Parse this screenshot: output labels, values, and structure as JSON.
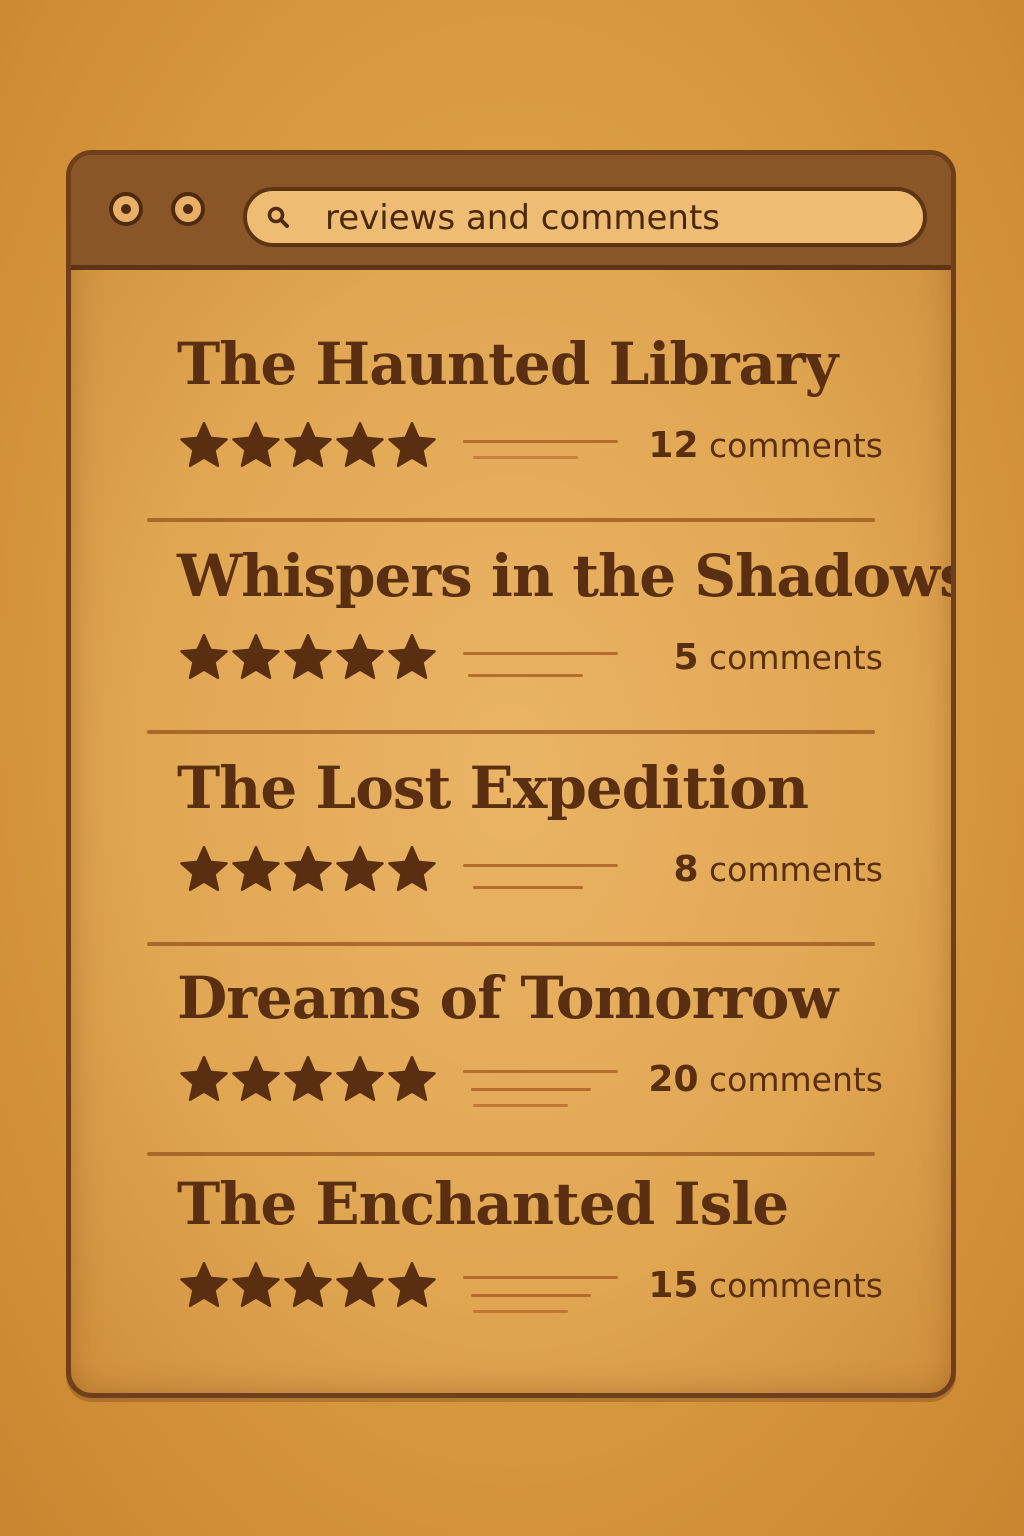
{
  "browser": {
    "search_value": "reviews and comments"
  },
  "reviews": [
    {
      "title": "The Haunted Library",
      "rating": 5,
      "comment_count": "12",
      "comment_label": "comments"
    },
    {
      "title": "Whispers in the Shadows",
      "rating": 5,
      "comment_count": "5",
      "comment_label": "comments"
    },
    {
      "title": "The Lost Expedition",
      "rating": 5,
      "comment_count": "8",
      "comment_label": "comments"
    },
    {
      "title": "Dreams of Tomorrow",
      "rating": 5,
      "comment_count": "20",
      "comment_label": "comments"
    },
    {
      "title": "The Enchanted Isle",
      "rating": 5,
      "comment_count": "15",
      "comment_label": "comments"
    }
  ],
  "colors": {
    "ink": "#5a2f11",
    "parchment": "#e0a652",
    "frame": "#8a5628"
  }
}
